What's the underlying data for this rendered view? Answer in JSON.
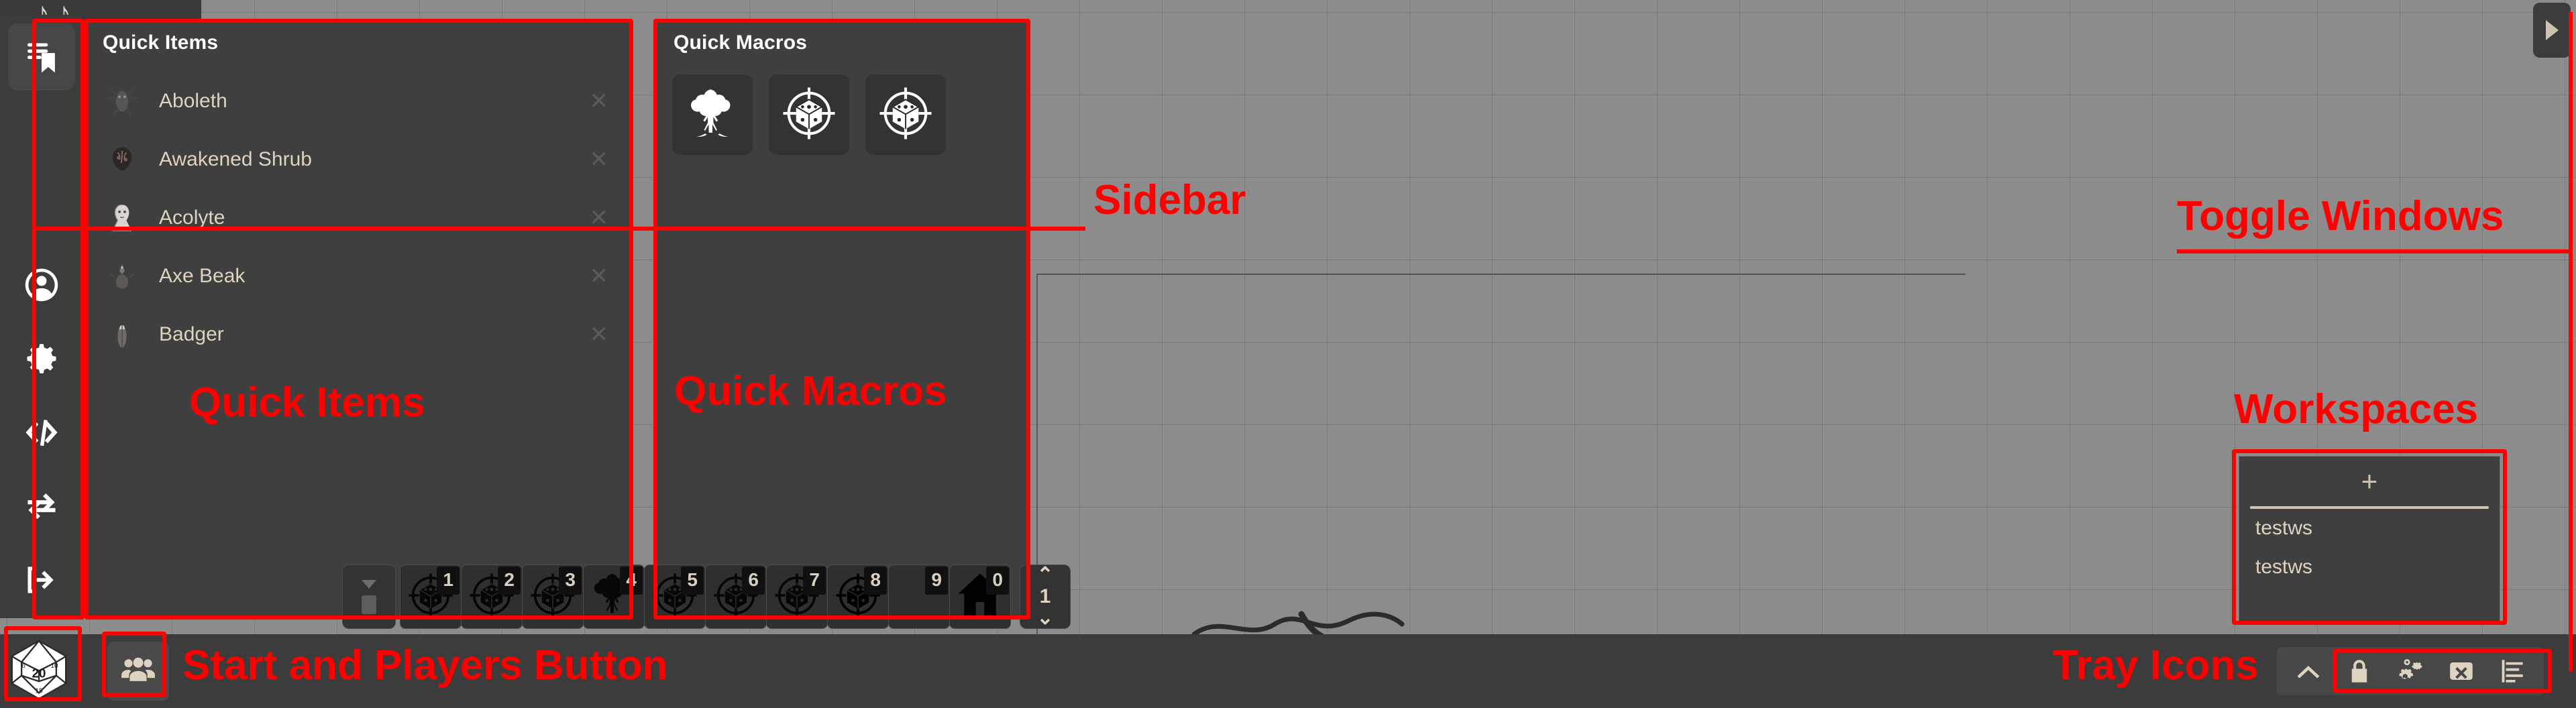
{
  "app": {
    "canvas_label": "scene-grid-canvas"
  },
  "music_bar": {
    "notes": [
      "♪",
      "♪"
    ]
  },
  "sidebar": {
    "items": [
      {
        "icon": "journal-bookmark-icon",
        "label": "Journal"
      },
      {
        "icon": "user-circle-icon",
        "label": "Account"
      },
      {
        "icon": "gear-icon",
        "label": "Settings"
      },
      {
        "icon": "code-brackets-icon",
        "label": "Macros"
      },
      {
        "icon": "sync-icon",
        "label": "Refresh"
      },
      {
        "icon": "logout-icon",
        "label": "Log Out"
      }
    ]
  },
  "quick_items": {
    "title": "Quick Items",
    "close_glyph": "✕",
    "items": [
      {
        "name": "Aboleth",
        "icon": "aboleth-token-icon"
      },
      {
        "name": "Awakened Shrub",
        "icon": "shrub-token-icon"
      },
      {
        "name": "Acolyte",
        "icon": "acolyte-token-icon"
      },
      {
        "name": "Axe Beak",
        "icon": "axe-beak-token-icon"
      },
      {
        "name": "Badger",
        "icon": "badger-token-icon"
      }
    ]
  },
  "quick_macros": {
    "title": "Quick Macros",
    "buttons": [
      {
        "icon": "tree-icon",
        "label": "Tree Macro"
      },
      {
        "icon": "dice-target-icon",
        "label": "Targeted Roll Macro"
      },
      {
        "icon": "dice-target-icon",
        "label": "Targeted Roll Macro"
      }
    ]
  },
  "hotbar": {
    "collapse_label": "Collapse Hotbar",
    "page": "1",
    "up_glyph": "⌃",
    "down_glyph": "⌄",
    "slots": [
      {
        "key": "1",
        "icon": "dice-target-icon",
        "bright": false
      },
      {
        "key": "2",
        "icon": "dice-target-icon",
        "bright": false
      },
      {
        "key": "3",
        "icon": "dice-target-icon",
        "bright": false
      },
      {
        "key": "4",
        "icon": "tree-icon",
        "bright": false
      },
      {
        "key": "5",
        "icon": "dice-target-icon",
        "bright": false
      },
      {
        "key": "6",
        "icon": "dice-target-icon",
        "bright": false
      },
      {
        "key": "7",
        "icon": "dice-target-icon",
        "bright": false
      },
      {
        "key": "8",
        "icon": "dice-target-icon",
        "bright": true
      },
      {
        "key": "9",
        "icon": "",
        "bright": false
      },
      {
        "key": "0",
        "icon": "house-icon",
        "bright": true
      }
    ]
  },
  "workspaces": {
    "add_glyph": "+",
    "items": [
      {
        "name": "testws"
      },
      {
        "name": "testws"
      }
    ]
  },
  "toggle_windows": {
    "label": "Toggle Windows",
    "glyph": "▶"
  },
  "taskbar": {
    "start_label": "Start",
    "start_icon": "d20-dice-icon",
    "players_label": "Players",
    "players_icon": "people-group-icon",
    "tray": [
      {
        "icon": "chevron-up-icon",
        "label": "Show hidden icons"
      },
      {
        "icon": "lock-icon",
        "label": "Lock"
      },
      {
        "icon": "gears-icon",
        "label": "Settings"
      },
      {
        "icon": "close-box-icon",
        "label": "Close"
      },
      {
        "icon": "bar-chart-icon",
        "label": "Stats"
      }
    ]
  },
  "annotations": {
    "sidebar": "Sidebar",
    "quick_items": "Quick Items",
    "quick_macros": "Quick Macros",
    "toggle_windows": "Toggle Windows",
    "workspaces": "Workspaces",
    "start_and_players": "Start and Players Button",
    "tray_icons": "Tray Icons",
    "color": "#ff0000"
  }
}
